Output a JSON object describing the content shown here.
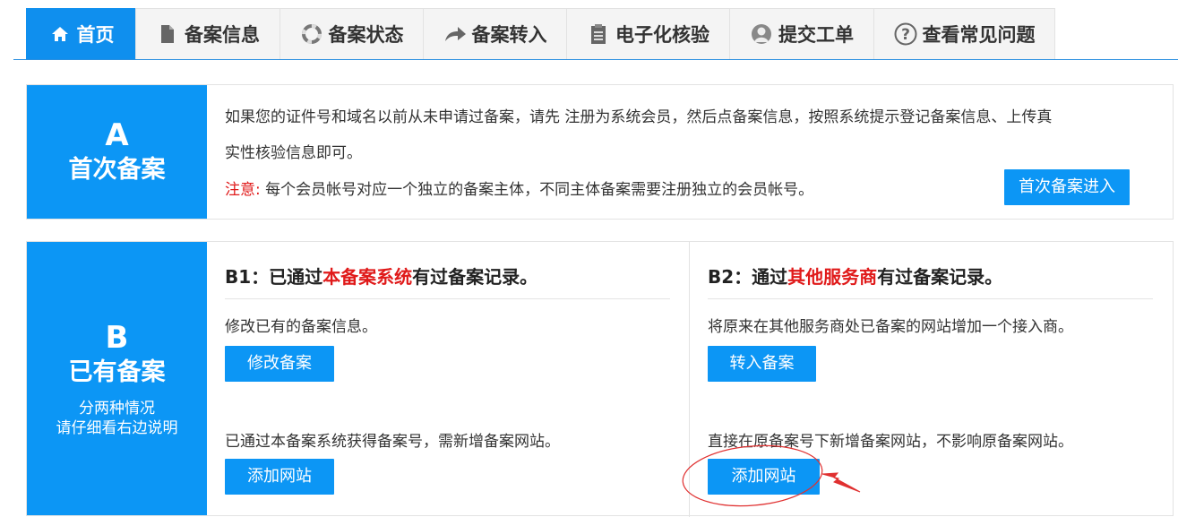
{
  "tabs": [
    {
      "label": "首页",
      "icon": "home-icon"
    },
    {
      "label": "备案信息",
      "icon": "document-icon"
    },
    {
      "label": "备案状态",
      "icon": "lifebuoy-icon"
    },
    {
      "label": "备案转入",
      "icon": "arrow-forward-icon"
    },
    {
      "label": "电子化核验",
      "icon": "clipboard-icon"
    },
    {
      "label": "提交工单",
      "icon": "user-icon"
    },
    {
      "label": "查看常见问题",
      "icon": "question-icon"
    }
  ],
  "section_a": {
    "letter": "A",
    "title": "首次备案",
    "desc_line1": "如果您的证件号和域名以前从未申请过备案，请先 注册为系统会员，然后点备案信息，按照系统提示登记备案信息、上传真",
    "desc_line2": "实性核验信息即可。",
    "note_label": "注意:",
    "note_text": "每个会员帐号对应一个独立的备案主体，不同主体备案需要注册独立的会员帐号。",
    "button": "首次备案进入"
  },
  "section_b": {
    "letter": "B",
    "title": "已有备案",
    "sub_line1": "分两种情况",
    "sub_line2": "请仔细看右边说明",
    "b1": {
      "heading_prefix": "B1：已通过",
      "heading_highlight": "本备案系统",
      "heading_suffix": "有过备案记录。",
      "text1": "修改已有的备案信息。",
      "button1": "修改备案",
      "text2": "已通过本备案系统获得备案号，需新增备案网站。",
      "button2": "添加网站"
    },
    "b2": {
      "heading_prefix": "B2：通过",
      "heading_highlight": "其他服务商",
      "heading_suffix": "有过备案记录。",
      "text1": "将原来在其他服务商处已备案的网站增加一个接入商。",
      "button1": "转入备案",
      "text2": "直接在原备案号下新增备案网站，不影响原备案网站。",
      "button2": "添加网站"
    }
  },
  "colors": {
    "accent": "#0c96f5",
    "highlight": "#e01a1a",
    "annotation": "#e03030"
  }
}
